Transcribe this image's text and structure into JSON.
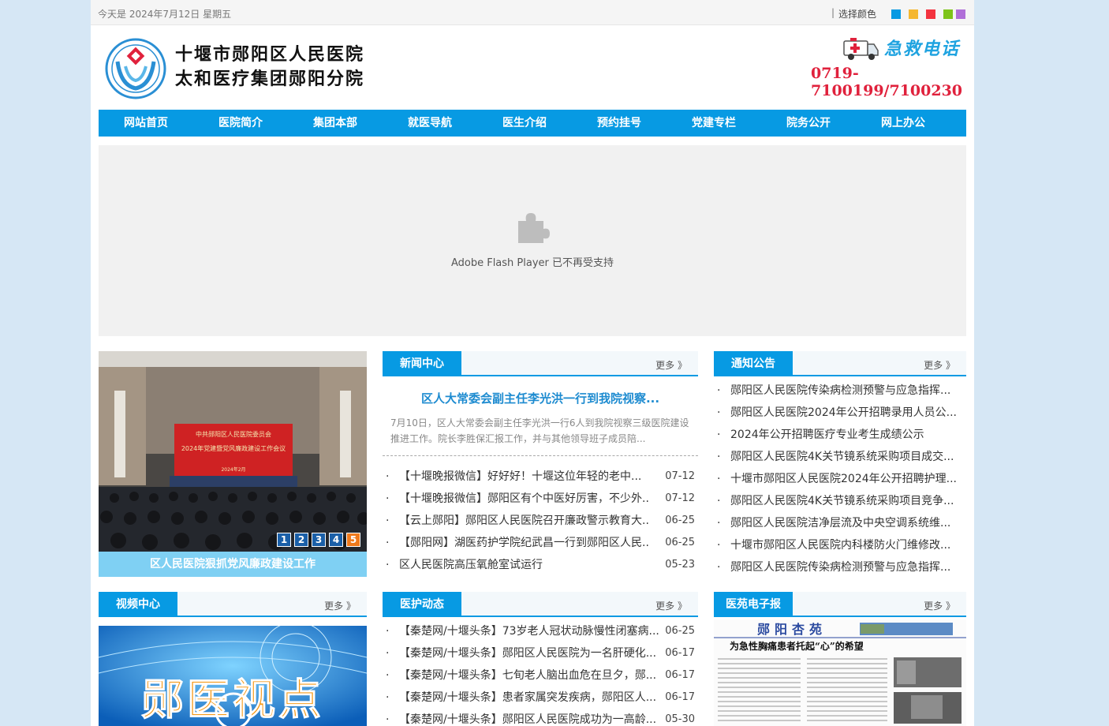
{
  "topbar": {
    "date_text": "今天是 2024年7月12日 星期五",
    "separator": "|",
    "choose_color_label": "选择颜色",
    "swatches": [
      "#079ae3",
      "#f5b730",
      "#f3333f",
      "#7ec41a",
      "#b06fd8"
    ]
  },
  "header": {
    "hospital_name_line1": "十堰市郧阳区人民医院",
    "hospital_name_line2": "太和医疗集团郧阳分院",
    "emergency_label": "急救电话",
    "phone": "0719-7100199/7100230"
  },
  "nav": {
    "items": [
      "网站首页",
      "医院简介",
      "集团本部",
      "就医导航",
      "医生介绍",
      "预约挂号",
      "党建专栏",
      "院务公开",
      "网上办公"
    ]
  },
  "flash": {
    "message": "Adobe Flash Player 已不再受支持"
  },
  "slideshow": {
    "caption": "区人民医院狠抓党风廉政建设工作",
    "banner_line1": "中共郧阳区人民医院委员会",
    "banner_line2": "2024年党建暨党风廉政建设工作会议",
    "banner_line3": "2024年2月",
    "pages": [
      "1",
      "2",
      "3",
      "4",
      "5"
    ],
    "active_page": "5"
  },
  "news": {
    "title": "新闻中心",
    "more": "更多 》",
    "headline": "区人大常委会副主任李光洪一行到我院视察...",
    "summary": "7月10日，区人大常委会副主任李光洪一行6人到我院视察三级医院建设推进工作。院长李胜保汇报工作，并与其他领导班子成员陪...",
    "items": [
      {
        "title": "【十堰晚报微信】好好好！十堰这位年轻的老中...",
        "date": "07-12"
      },
      {
        "title": "【十堰晚报微信】郧阳区有个中医好厉害，不少外...",
        "date": "07-12"
      },
      {
        "title": "【云上郧阳】郧阳区人民医院召开廉政警示教育大...",
        "date": "06-25"
      },
      {
        "title": "【郧阳网】湖医药护学院纪武昌一行到郧阳区人民...",
        "date": "06-25"
      },
      {
        "title": "区人民医院高压氧舱室试运行",
        "date": "05-23"
      }
    ]
  },
  "notice": {
    "title": "通知公告",
    "more": "更多 》",
    "items": [
      "郧阳区人民医院传染病检测预警与应急指挥...",
      "郧阳区人民医院2024年公开招聘录用人员公...",
      "2024年公开招聘医疗专业考生成绩公示",
      "郧阳区人民医院4K关节镜系统采购项目成交...",
      "十堰市郧阳区人民医院2024年公开招聘护理...",
      "郧阳区人民医院4K关节镜系统采购项目竞争...",
      "郧阳区人民医院洁净层流及中央空调系统维...",
      "十堰市郧阳区人民医院内科楼防火门维修改...",
      "郧阳区人民医院传染病检测预警与应急指挥..."
    ]
  },
  "video": {
    "title": "视频中心",
    "more": "更多 》",
    "banner_text": "郧医视点"
  },
  "nursing": {
    "title": "医护动态",
    "more": "更多 》",
    "items": [
      {
        "title": "【秦楚网/十堰头条】73岁老人冠状动脉慢性闭塞病...",
        "date": "06-25"
      },
      {
        "title": "【秦楚网/十堰头条】郧阳区人民医院为一名肝硬化...",
        "date": "06-17"
      },
      {
        "title": "【秦楚网/十堰头条】七旬老人脑出血危在旦夕，郧...",
        "date": "06-17"
      },
      {
        "title": "【秦楚网/十堰头条】患者家属突发疾病，郧阳区人...",
        "date": "06-17"
      },
      {
        "title": "【秦楚网/十堰头条】郧阳区人民医院成功为一高龄...",
        "date": "05-30"
      }
    ]
  },
  "epaper": {
    "title": "医苑电子报",
    "more": "更多 》",
    "masthead": "郧阳杏苑",
    "headline": "为急性胸痛患者托起“心”的希望"
  }
}
